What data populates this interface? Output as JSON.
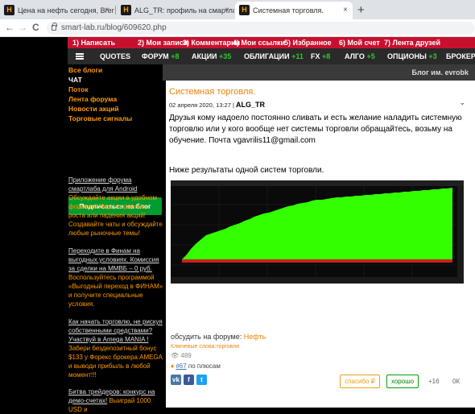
{
  "browser": {
    "tabs": [
      {
        "title": "Цена на нефть сегодня, Brent",
        "close": "×"
      },
      {
        "title": "ALG_TR: профиль на смартлабе",
        "close": "×"
      },
      {
        "title": "Системная торговля.",
        "close": "×"
      }
    ],
    "new_tab": "+",
    "back": "←",
    "forward": "→",
    "reload": "C",
    "url": "smart-lab.ru/blog/609620.php"
  },
  "top_menu": [
    "1) Написать",
    "2) Мои записи",
    "3) Комментарии",
    "4) Мои ссылки",
    "5) Избранное",
    "6) Мой счет",
    "7) Лента друзей"
  ],
  "main_menu": [
    {
      "label": "QUOTES",
      "count": ""
    },
    {
      "label": "ФОРУМ",
      "count": "+8"
    },
    {
      "label": "АКЦИИ",
      "count": "+35"
    },
    {
      "label": "ОБЛИГАЦИИ",
      "count": "+11"
    },
    {
      "label": "FX",
      "count": "+8"
    },
    {
      "label": "АЛГО",
      "count": "+5"
    },
    {
      "label": "ОПЦИОНЫ",
      "count": "+3"
    },
    {
      "label": "БРОКЕРЫ",
      "count": ""
    }
  ],
  "sidebar": {
    "links": [
      "Все блоги",
      "ЧАТ",
      "Поток",
      "Лента форума",
      "Новости акций",
      "Торговые сигналы"
    ],
    "subscribe": "Подписаться на блог",
    "promo1_link": "Приложение форума смартлаба для Android",
    "promo1_text": "Обсуждайте акции в удобном формате! Ищите причины роста или падения акций! Создавайте чаты и обсуждайте любые рыночные темы!",
    "promo2_link": "Переходите в Финам на выгодных условиях. Комиссия за сделки на ММВБ – 0 руб.",
    "promo2_text": "Воспользуйтесь программой «Выгодный переход в ФИНАМ» и получите специальные условия.",
    "promo3_link": "Как начать торговлю, не рискуя собственными средствами? Участвуй в Amega MANIA !",
    "promo3_text": "Забери бездепозитный бонус $133 у Форекс брокера AMEGA и выводи прибыль в любой момент!!!",
    "promo4_link": "Битва трейдеров: конкурс на демо-счетах!",
    "promo4_text": "Выиграй 1000 USD и"
  },
  "blog_header": "Блог им. evrobk",
  "post": {
    "title": "Системная торговля.",
    "date": "02 апреля 2020, 13:27",
    "separator": "|",
    "author": "ALG_TR",
    "body": "Друзья кому надоело постоянно сливать и есть желание наладить системную торговлю или у кого вообще нет  системы торговли обращайтесь, возьму на обучение. Почта  vgavrilis11@gmail.com",
    "body2": "Ниже результаты одной  систем торговли.",
    "discuss_label": "обсудить на форуме:",
    "discuss_link": "Нефть",
    "keywords": "Ключевые слова:торговля",
    "views": "489",
    "plus_link": "#67",
    "plus_text": "по плюсам",
    "thanks": "спасибо ₽",
    "good": "хорошо",
    "count_plus": "+16",
    "count_k": "0К"
  },
  "colors": {
    "accent": "#ff9900",
    "menu_red": "#c8102e",
    "equity_green": "#33ff00",
    "subscribe_green": "#009c2e"
  }
}
